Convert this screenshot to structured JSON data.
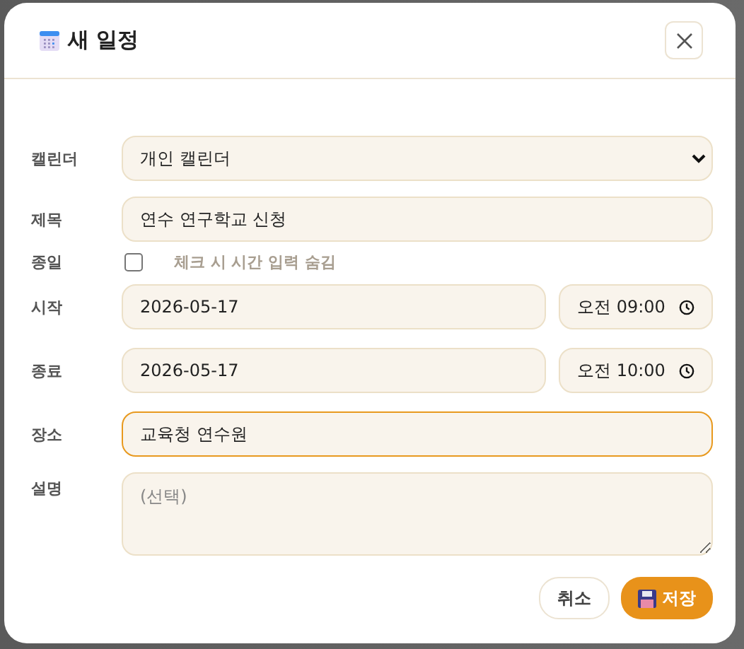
{
  "dialog": {
    "title": "새 일정"
  },
  "fields": [
    {
      "kind": "select",
      "label": "캘린더",
      "value": "개인 캘린더"
    },
    {
      "kind": "text",
      "label": "제목",
      "value": "연수 연구학교 신청",
      "focused": false
    },
    {
      "kind": "checkbox",
      "label": "종일",
      "checked": false,
      "hint": "체크 시 시간 입력 숨김"
    },
    {
      "kind": "datetime",
      "label": "시작",
      "date": "2026-05-17",
      "time": "오전 09:00"
    },
    {
      "kind": "datetime",
      "label": "종료",
      "date": "2026-05-17",
      "time": "오전 10:00"
    },
    {
      "kind": "text",
      "label": "장소",
      "value": "교육청 연수원",
      "focused": true
    },
    {
      "kind": "textarea",
      "label": "설명",
      "placeholder": "(선택)"
    }
  ],
  "buttons": [
    {
      "kind": "secondary",
      "label": "취소"
    },
    {
      "kind": "primary",
      "label": "저장"
    }
  ]
}
